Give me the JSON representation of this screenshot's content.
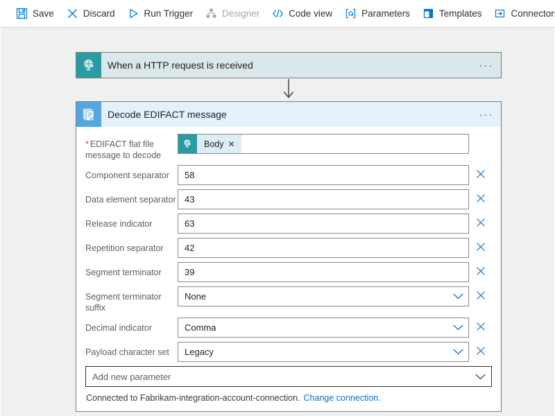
{
  "toolbar": {
    "items": [
      {
        "label": "Save",
        "icon": "save-icon",
        "disabled": false
      },
      {
        "label": "Discard",
        "icon": "discard-icon",
        "disabled": false
      },
      {
        "label": "Run Trigger",
        "icon": "run-icon",
        "disabled": false
      },
      {
        "label": "Designer",
        "icon": "designer-icon",
        "disabled": true
      },
      {
        "label": "Code view",
        "icon": "code-view-icon",
        "disabled": false
      },
      {
        "label": "Parameters",
        "icon": "parameters-icon",
        "disabled": false
      },
      {
        "label": "Templates",
        "icon": "templates-icon",
        "disabled": false
      },
      {
        "label": "Connectors",
        "icon": "connectors-icon",
        "disabled": false
      }
    ],
    "help_label": "?"
  },
  "trigger_card": {
    "title": "When a HTTP request is received",
    "icon": "http-globe-icon",
    "menu_label": "···"
  },
  "action_card": {
    "title": "Decode EDIFACT message",
    "icon": "edifact-documents-icon",
    "menu_label": "···",
    "required_marker": "*",
    "token": {
      "label": "Body",
      "remove_label": "✕",
      "icon": "http-globe-icon"
    },
    "fields": [
      {
        "label": "EDIFACT flat file message to decode",
        "value": "",
        "type": "token",
        "required": true,
        "deletable": false
      },
      {
        "label": "Component separator",
        "value": "58",
        "type": "text",
        "required": false,
        "deletable": true
      },
      {
        "label": "Data element separator",
        "value": "43",
        "type": "text",
        "required": false,
        "deletable": true
      },
      {
        "label": "Release indicator",
        "value": "63",
        "type": "text",
        "required": false,
        "deletable": true
      },
      {
        "label": "Repetition separator",
        "value": "42",
        "type": "text",
        "required": false,
        "deletable": true
      },
      {
        "label": "Segment terminator",
        "value": "39",
        "type": "text",
        "required": false,
        "deletable": true
      },
      {
        "label": "Segment terminator suffix",
        "value": "None",
        "type": "select",
        "required": false,
        "deletable": true
      },
      {
        "label": "Decimal indicator",
        "value": "Comma",
        "type": "select",
        "required": false,
        "deletable": true
      },
      {
        "label": "Payload character set",
        "value": "Legacy",
        "type": "select",
        "required": false,
        "deletable": true
      }
    ],
    "add_parameter_label": "Add new parameter",
    "connection_text": "Connected to Fabrikam-integration-account-connection.",
    "change_connection_label": "Change connection."
  },
  "colors": {
    "accent_blue": "#0078d4",
    "link_blue": "#0f6cbd",
    "teal": "#2a9ba5",
    "icon_blue": "#55a6de",
    "required_red": "#d13438",
    "trigger_header": "#dae8ec",
    "action_header": "#e4f1fa",
    "canvas": "#f0f0f0"
  }
}
